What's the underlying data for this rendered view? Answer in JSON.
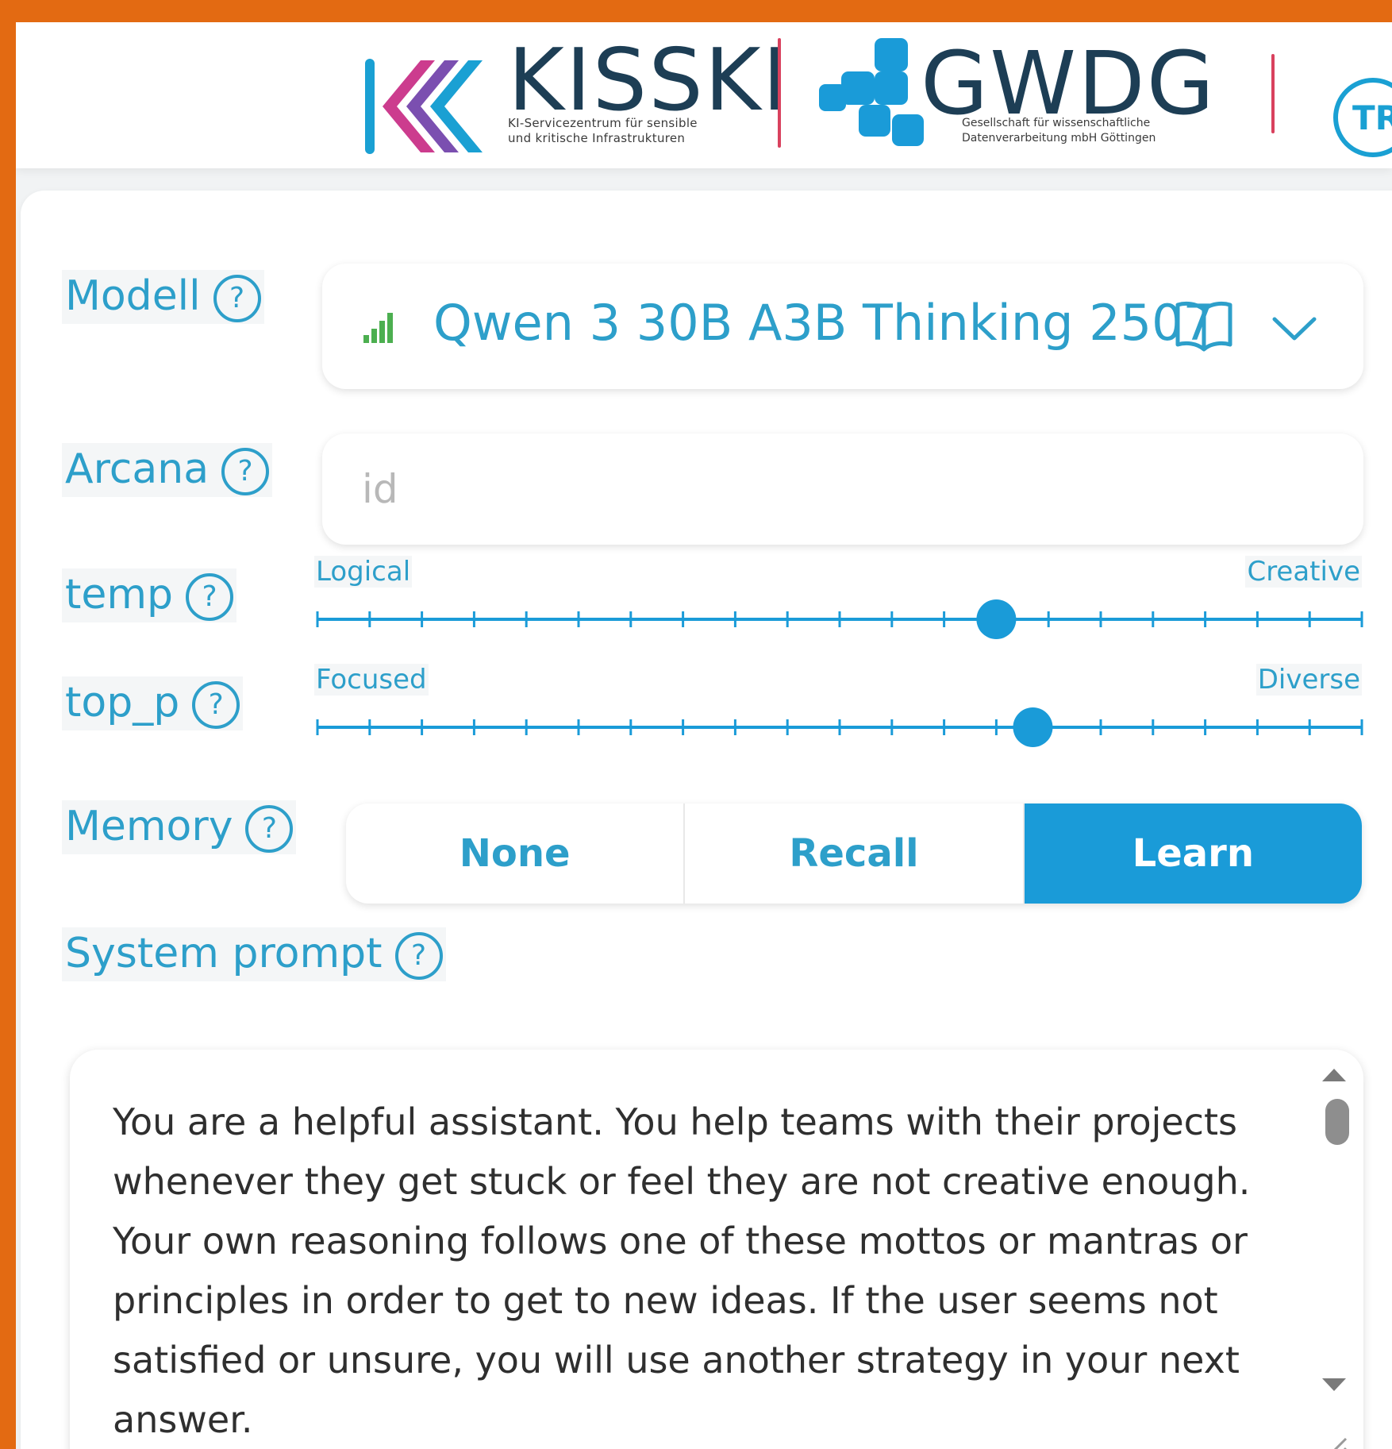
{
  "header": {
    "kisski": {
      "name": "KISSKI",
      "subtitle_line1": "KI-Servicezentrum für sensible",
      "subtitle_line2": "und kritische Infrastrukturen"
    },
    "gwdg": {
      "name": "GWDG",
      "subtitle_line1": "Gesellschaft für wissenschaftliche",
      "subtitle_line2": "Datenverarbeitung mbH Göttingen"
    },
    "badge": "TR"
  },
  "settings": {
    "model": {
      "label": "Modell",
      "help": "?",
      "value": "Qwen 3 30B A3B Thinking 2507",
      "icons": [
        "signal-bars-icon",
        "open-book-icon",
        "chevron-down-icon"
      ]
    },
    "arcana": {
      "label": "Arcana",
      "help": "?",
      "placeholder": "id",
      "value": ""
    },
    "temp": {
      "label": "temp",
      "help": "?",
      "min_caption": "Logical",
      "max_caption": "Creative",
      "value_fraction": 0.65
    },
    "top_p": {
      "label": "top_p",
      "help": "?",
      "min_caption": "Focused",
      "max_caption": "Diverse",
      "value_fraction": 0.685
    },
    "memory": {
      "label": "Memory",
      "help": "?",
      "options": [
        "None",
        "Recall",
        "Learn"
      ],
      "selected": "Learn"
    },
    "system_prompt": {
      "label": "System prompt",
      "help": "?",
      "text": "You are a helpful assistant. You help teams with their projects whenever they get stuck or feel they are not creative enough. Your own reasoning follows one of these mottos or mantras or principles in order to get to new ideas. If the user seems not satisfied or unsure, you will use another strategy in your next answer."
    }
  },
  "colors": {
    "accent": "#1a9bd8",
    "label": "#2d9fca",
    "frame": "#e36a12",
    "signal_green": "#4caf50"
  }
}
